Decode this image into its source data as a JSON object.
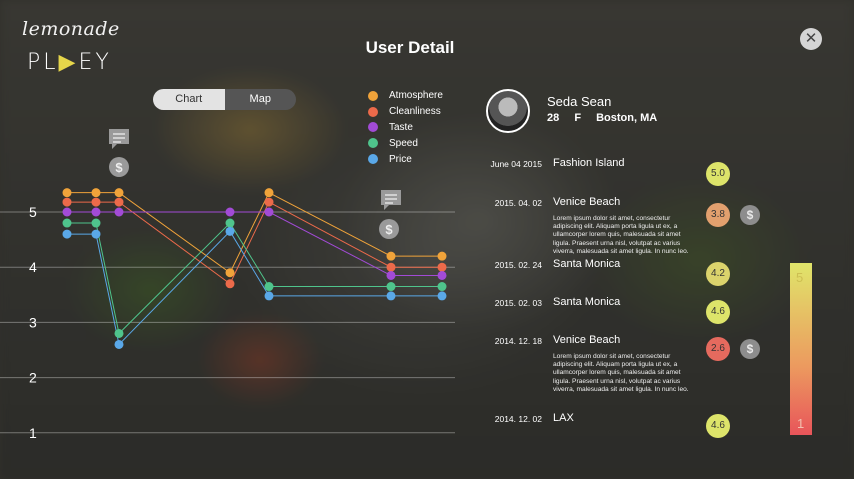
{
  "brand": {
    "script": "lemonade",
    "mark_pre": "PL",
    "mark_tri": "▶",
    "mark_post": "EY"
  },
  "page_title": "User Detail",
  "close_label": "✕",
  "toggle": {
    "chart": "Chart",
    "map": "Map"
  },
  "legend": [
    {
      "label": "Atmosphere",
      "color": "#f0a33a"
    },
    {
      "label": "Cleanliness",
      "color": "#ec6a4a"
    },
    {
      "label": "Taste",
      "color": "#a24bd6"
    },
    {
      "label": "Speed",
      "color": "#4fc48c"
    },
    {
      "label": "Price",
      "color": "#5aa8e8"
    }
  ],
  "profile": {
    "name": "Seda Sean",
    "age": "28",
    "gender": "F",
    "city": "Boston, MA"
  },
  "visits": [
    {
      "date": "June 04 2015",
      "place": "Fashion Island",
      "score": "5.0",
      "text": "",
      "dollar": false,
      "color": "#dde46a"
    },
    {
      "date": "2015. 04. 02",
      "place": "Venice Beach",
      "score": "3.8",
      "text": "Lorem ipsum dolor sit amet, consectetur adipiscing elit. Aliquam porta ligula ut ex, a ullamcorper lorem quis, malesuada sit amet ligula. Praesent urna nisl, volutpat ac varius viverra, malesuada sit amet ligula. In nunc leo.",
      "dollar": true,
      "color": "#e2a06e"
    },
    {
      "date": "2015. 02. 24",
      "place": "Santa Monica",
      "score": "4.2",
      "text": "",
      "dollar": false,
      "color": "#dbd36c"
    },
    {
      "date": "2015. 02. 03",
      "place": "Santa Monica",
      "score": "4.6",
      "text": "",
      "dollar": false,
      "color": "#dde46a"
    },
    {
      "date": "2014. 12. 18",
      "place": "Venice Beach",
      "score": "2.6",
      "text": "Lorem ipsum dolor sit amet, consectetur adipiscing elit. Aliquam porta ligula ut ex, a ullamcorper lorem quis, malesuada sit amet ligula. Praesent urna nisl, volutpat ac varius viverra, malesuada sit amet ligula. In nunc leo.",
      "dollar": true,
      "color": "#e56a5e"
    },
    {
      "date": "2014. 12. 02",
      "place": "LAX",
      "score": "4.6",
      "text": "",
      "dollar": false,
      "color": "#dde46a"
    }
  ],
  "scale": {
    "top": "5",
    "bottom": "1"
  },
  "chart_data": {
    "type": "line",
    "ylim": [
      1,
      5.4
    ],
    "yticks": [
      "5",
      "4",
      "3",
      "2",
      "1"
    ],
    "x": [
      1,
      2,
      3,
      4,
      5,
      6,
      7,
      8
    ],
    "note_icons": [
      {
        "x": 2,
        "type": "note"
      },
      {
        "x": 2,
        "type": "dollar"
      },
      {
        "x": 7,
        "type": "note"
      },
      {
        "x": 7,
        "type": "dollar"
      }
    ],
    "series": [
      {
        "name": "Atmosphere",
        "color": "#f0a33a",
        "values": [
          5.35,
          5.35,
          5.35,
          3.9,
          5.35,
          4.2,
          4.2
        ]
      },
      {
        "name": "Cleanliness",
        "color": "#ec6a4a",
        "values": [
          5.18,
          5.18,
          5.18,
          3.7,
          5.18,
          4.0,
          4.0
        ]
      },
      {
        "name": "Taste",
        "color": "#a24bd6",
        "values": [
          5.0,
          5.0,
          5.0,
          5.0,
          5.0,
          3.85,
          3.85
        ]
      },
      {
        "name": "Speed",
        "color": "#4fc48c",
        "values": [
          4.8,
          4.8,
          2.8,
          4.8,
          3.65,
          3.65,
          3.65
        ]
      },
      {
        "name": "Price",
        "color": "#5aa8e8",
        "values": [
          4.6,
          4.6,
          2.6,
          4.65,
          3.48,
          3.48,
          3.48
        ]
      }
    ]
  }
}
